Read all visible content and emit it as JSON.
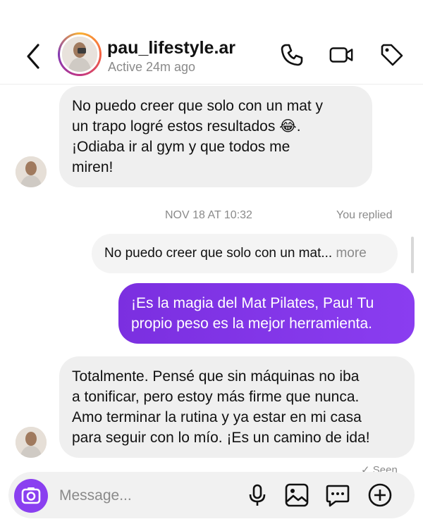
{
  "header": {
    "username": "pau_lifestyle.ar",
    "status": "Active 24m ago",
    "icons": [
      "back-icon",
      "phone-icon",
      "video-icon",
      "tag-icon"
    ]
  },
  "messages": {
    "m1": {
      "line1": "No puedo creer que solo con un mat y",
      "line2": "un trapo logré estos resultados 😂.",
      "line3": "¡Odiaba ir al gym y que todos me",
      "line4": "miren!"
    },
    "timestamp": "NOV 18 AT 10:32",
    "you_replied": "You replied",
    "quote": {
      "text": "No puedo creer que solo con un mat...",
      "more": "more"
    },
    "m2": {
      "line1": "¡Es la magia del Mat Pilates, Pau! Tu",
      "line2": "propio peso es la mejor herramienta."
    },
    "m3": {
      "line1": "Totalmente. Pensé que sin máquinas no iba",
      "line2": "a tonificar, pero estoy más firme que nunca.",
      "line3": "Amo terminar la rutina y ya estar en mi casa",
      "line4": "para seguir con lo mío. ¡Es un camino de ida!"
    },
    "seen": "Seen"
  },
  "composer": {
    "placeholder": "Message...",
    "icons": [
      "camera-icon",
      "microphone-icon",
      "image-icon",
      "sticker-icon",
      "plus-icon"
    ]
  },
  "colors": {
    "accent": "#8a3ff0",
    "incoming_bubble": "#efefef",
    "muted_text": "#8a8a8a"
  }
}
